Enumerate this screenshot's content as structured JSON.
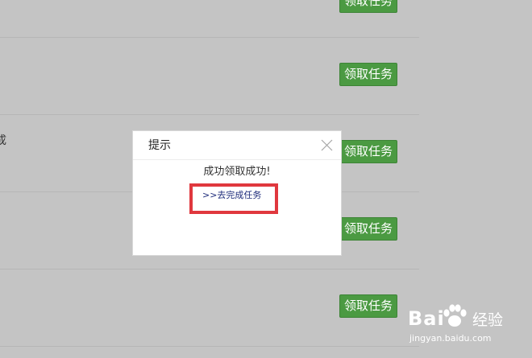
{
  "task_list": {
    "claim_button_label": "领取任务",
    "row_text_fragment": "成"
  },
  "dialog": {
    "title": "提示",
    "message": "成功领取成功!",
    "link_label": ">>去完成任务"
  },
  "watermark": {
    "brand": "Bai 经验",
    "url": "jingyan.baidu.com"
  },
  "colors": {
    "overlay_gray": "#c4c4c4",
    "button_green": "#4b9a42",
    "highlight_red": "#e0383e",
    "link_navy": "#1c2a7a"
  }
}
